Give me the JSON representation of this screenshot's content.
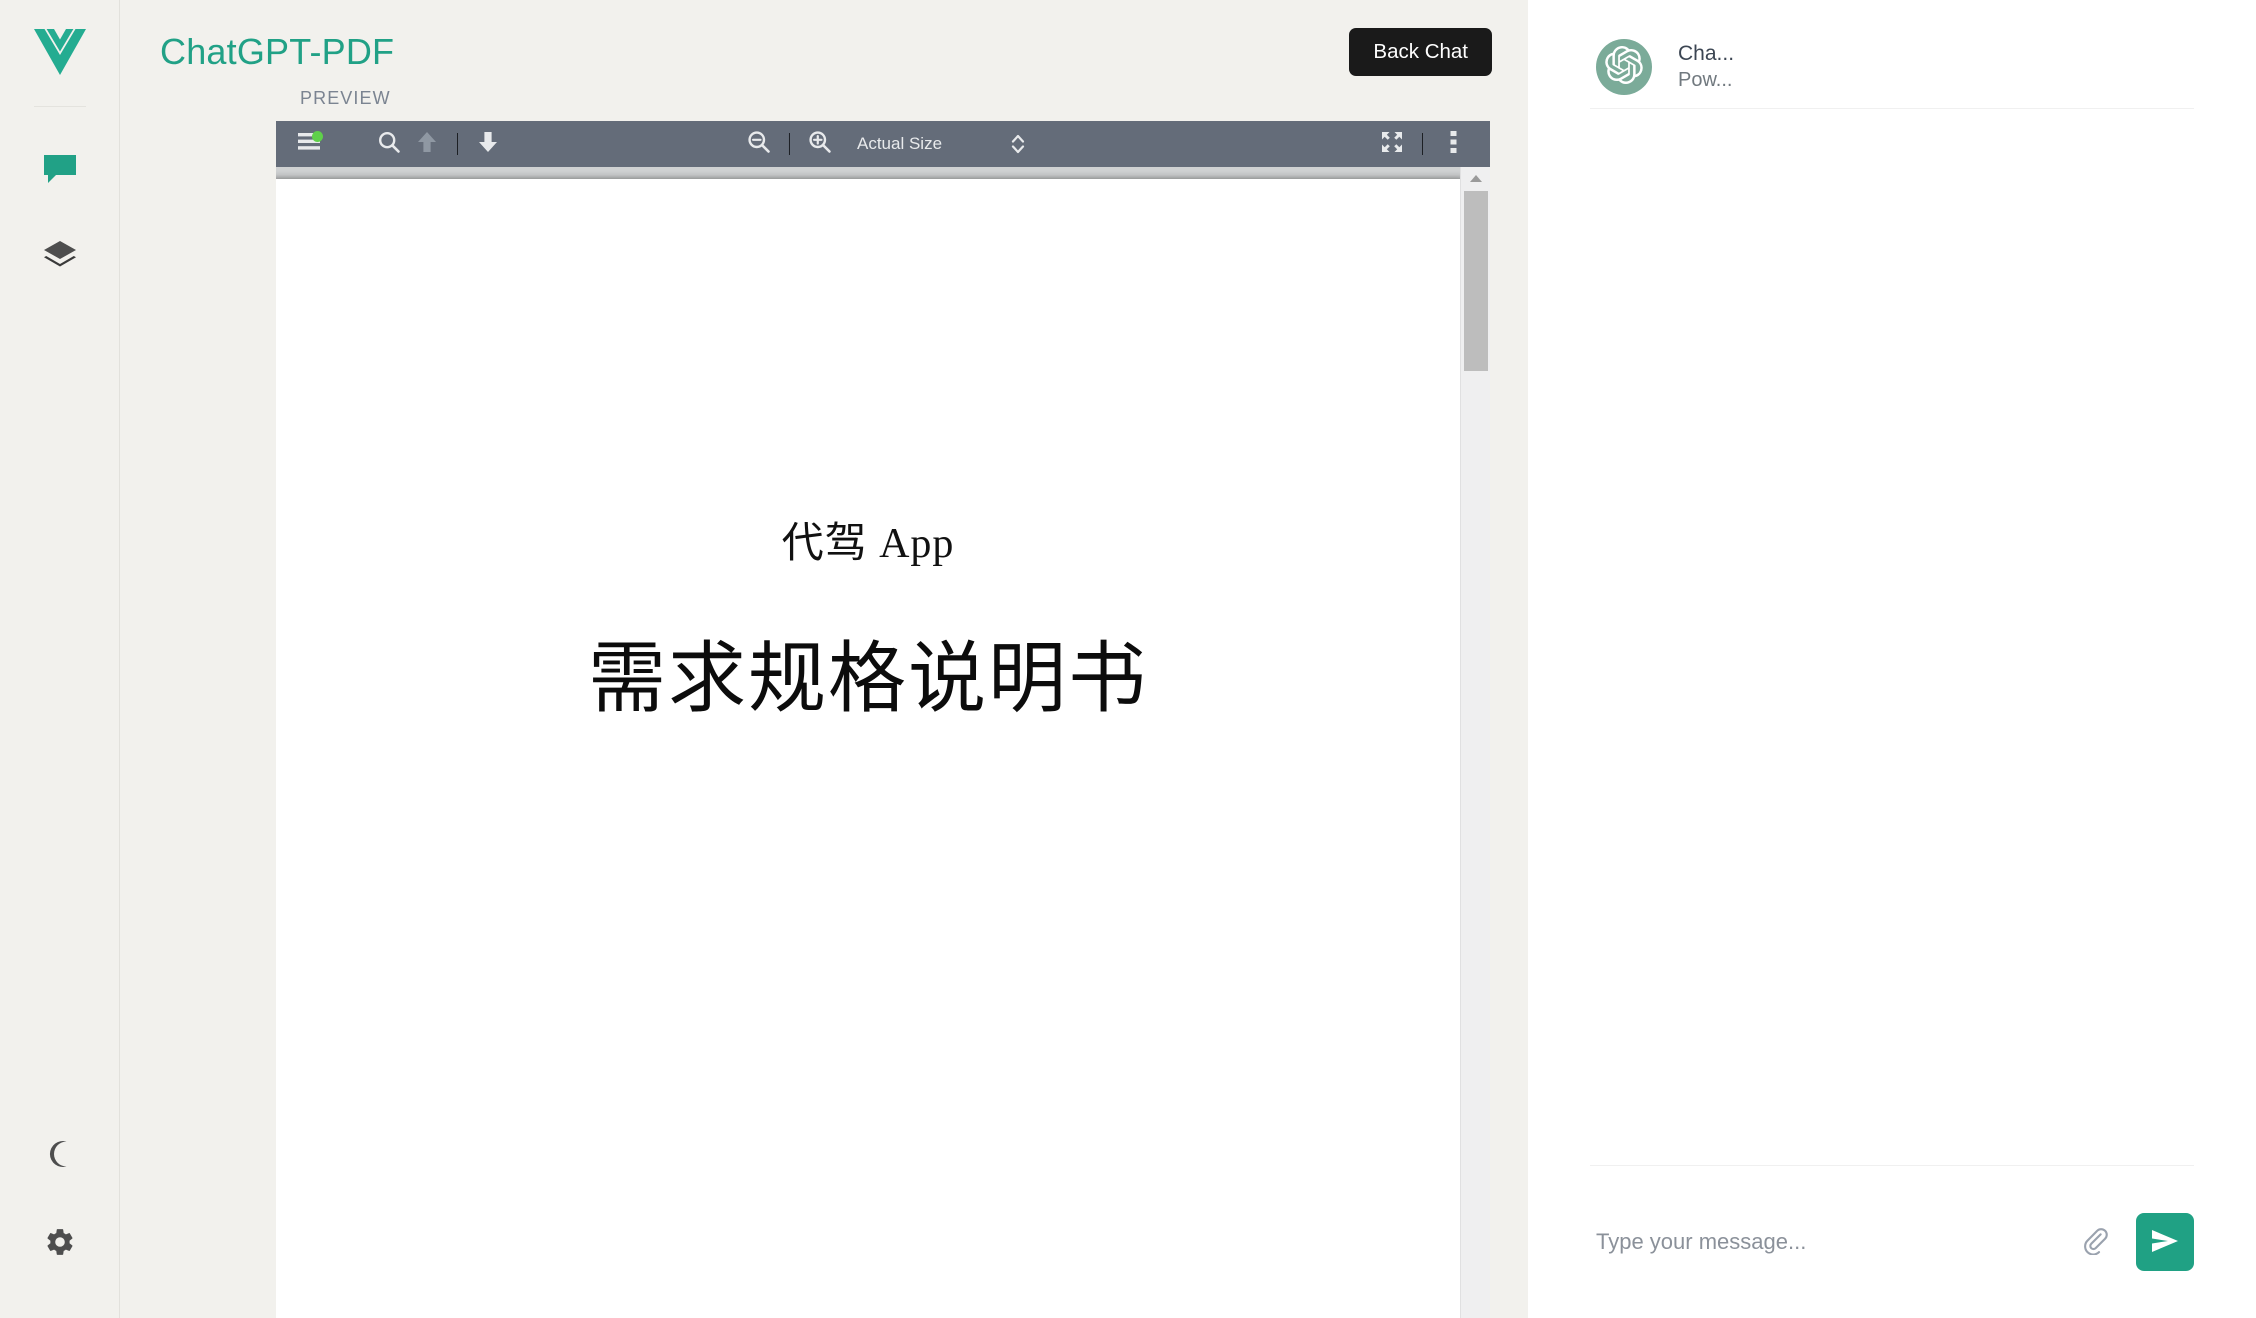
{
  "rail": {
    "logo_icon": "vue-logo-icon",
    "items": [
      {
        "icon": "chat-bubble-icon",
        "name": "rail-item-chat",
        "active": true
      },
      {
        "icon": "layers-icon",
        "name": "rail-item-layers",
        "active": false
      }
    ],
    "bottom_items": [
      {
        "icon": "moon-icon",
        "name": "rail-item-dark-mode"
      },
      {
        "icon": "gear-icon",
        "name": "rail-item-settings"
      }
    ]
  },
  "header": {
    "title": "ChatGPT-PDF",
    "back_chat_label": "Back Chat",
    "accent_color": "#21a186",
    "button_bg": "#1a1a1a"
  },
  "preview": {
    "label": "PREVIEW"
  },
  "pdf_toolbar": {
    "sidebar_toggle_icon": "hamburger-menu-icon",
    "sidebar_toggle_badge_color": "#5fd04a",
    "search_icon": "search-icon",
    "prev_page_icon": "arrow-up-icon",
    "next_page_icon": "arrow-down-icon",
    "zoom_out_icon": "zoom-out-icon",
    "zoom_in_icon": "zoom-in-icon",
    "zoom_level": "Actual Size",
    "zoom_select_arrows_icon": "chevron-up-down-icon",
    "presentation_icon": "presentation-mode-icon",
    "more_icon": "more-vertical-icon",
    "toolbar_bg": "#646c79"
  },
  "pdf_document": {
    "title_line1": "代驾 App",
    "title_line2": "需求规格说明书"
  },
  "chat": {
    "avatar_icon": "openai-logo-icon",
    "avatar_bg": "#7bab99",
    "bot_name": "Cha...",
    "bot_subtitle": "Pow...",
    "input_placeholder": "Type your message...",
    "input_value": "",
    "attach_icon": "paperclip-icon",
    "send_icon": "send-icon",
    "send_button_color": "#20a184"
  }
}
